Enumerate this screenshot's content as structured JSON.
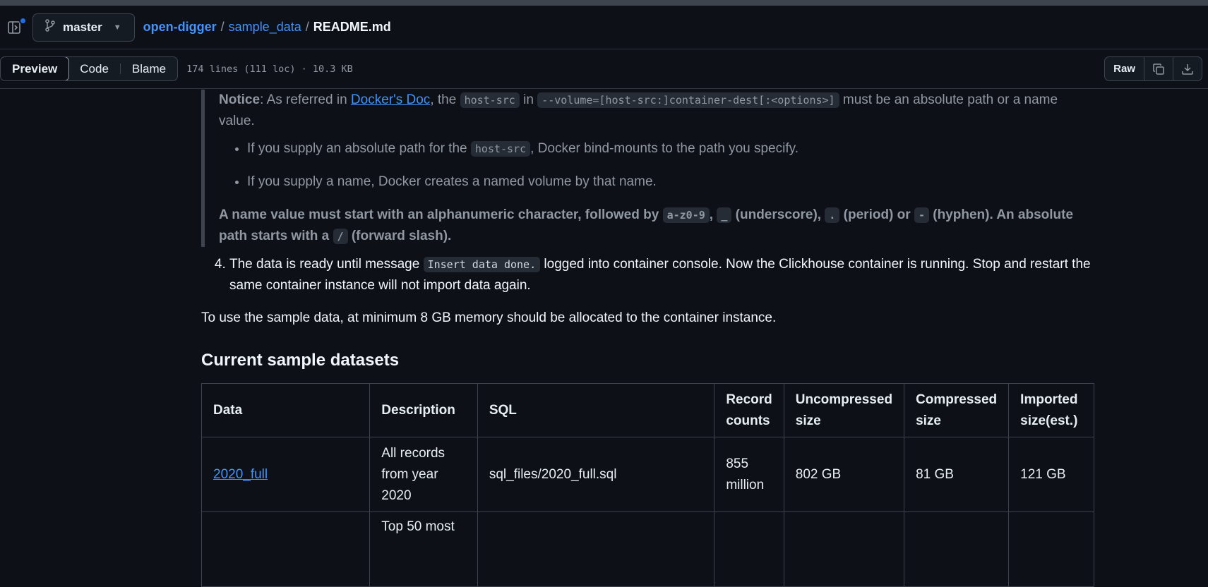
{
  "header": {
    "branch": "master",
    "breadcrumb": {
      "repo": "open-digger",
      "folder": "sample_data",
      "file": "README.md",
      "sep": "/"
    }
  },
  "filebar": {
    "tabs": [
      "Preview",
      "Code",
      "Blame"
    ],
    "info": "174 lines (111 loc) · 10.3 KB",
    "raw_label": "Raw"
  },
  "notice": {
    "label": "Notice",
    "text1": ": As referred in ",
    "link": "Docker's Doc",
    "text2": ", the ",
    "code1": "host-src",
    "text3": " in ",
    "code2": "--volume=[host-src:]container-dest[:<options>]",
    "text4": " must be an absolute path or a name value.",
    "bullet1_a": "If you supply an absolute path for the ",
    "bullet1_code": "host-src",
    "bullet1_b": ", Docker bind-mounts to the path you specify.",
    "bullet2": "If you supply a name, Docker creates a named volume by that name.",
    "rule_a": "A name value must start with an alphanumeric character, followed by ",
    "rule_code1": "a-z0-9",
    "rule_sep1": ", ",
    "rule_code2": "_",
    "rule_b": " (underscore), ",
    "rule_code3": ".",
    "rule_c": " (period) or ",
    "rule_code4": "-",
    "rule_d": " (hyphen). An absolute path starts with a ",
    "rule_code5": "/",
    "rule_e": " (forward slash)."
  },
  "step4": {
    "a": "The data is ready until message ",
    "code": "Insert data done.",
    "b": " logged into container console. Now the Clickhouse container is running. Stop and restart the same container instance will not import data again."
  },
  "memory_note": "To use the sample data, at minimum 8 GB memory should be allocated to the container instance.",
  "section_title": "Current sample datasets",
  "table": {
    "headers": [
      "Data",
      "Description",
      "SQL",
      "Record counts",
      "Uncompressed size",
      "Compressed size",
      "Imported size(est.)"
    ],
    "rows": [
      [
        "2020_full",
        "All records from year 2020",
        "sql_files/2020_full.sql",
        "855 million",
        "802 GB",
        "81 GB",
        "121 GB"
      ],
      [
        "",
        "Top 50 most",
        "",
        "",
        "",
        "",
        ""
      ]
    ]
  },
  "colors": {
    "bg": "#0d1117",
    "link": "#4493f8",
    "border": "#3d444d",
    "muted": "#9198a1"
  }
}
